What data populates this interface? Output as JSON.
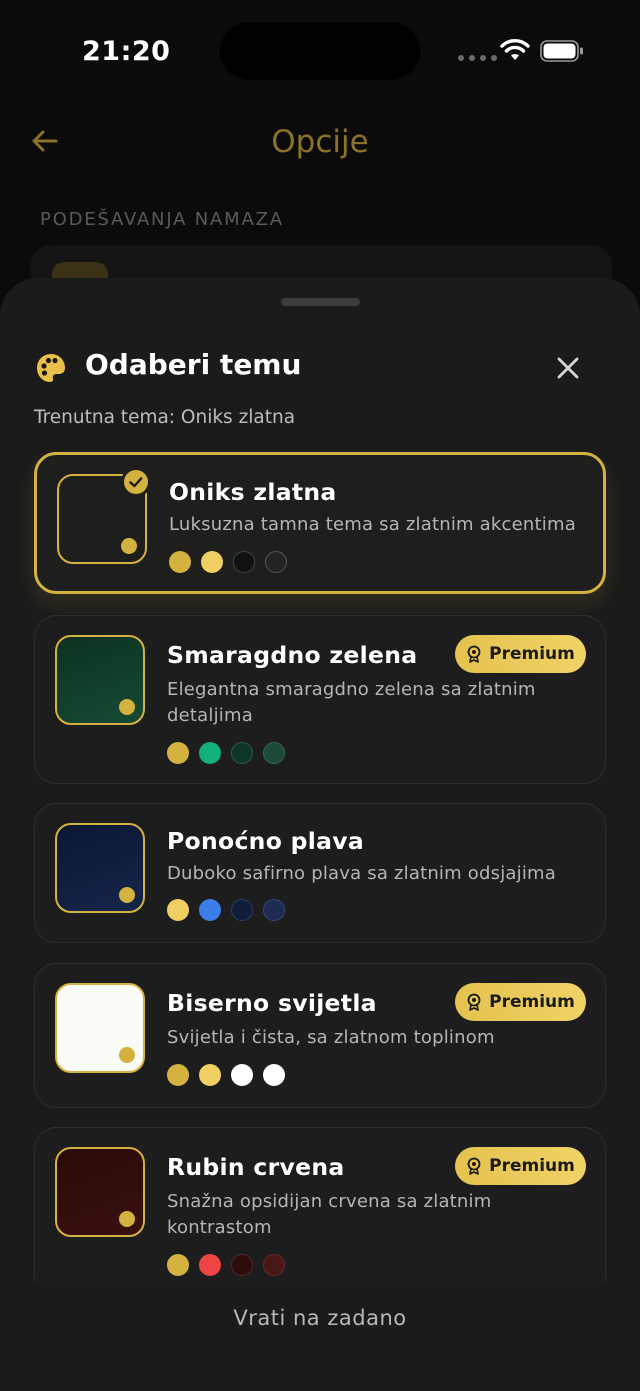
{
  "status": {
    "time": "21:20"
  },
  "page": {
    "title": "Opcije",
    "section": "PODEŠAVANJA NAMAZA"
  },
  "sheet": {
    "title": "Odaberi temu",
    "current_theme": "Trenutna tema: Oniks zlatna",
    "reset_label": "Vrati na zadano",
    "premium_label": "Premium"
  },
  "colors": {
    "accent": "#d4b23f",
    "sheet_bg": "#1b1b1b",
    "card_bg": "#1d1d1d"
  },
  "themes": [
    {
      "name": "Oniks zlatna",
      "desc": "Luksuzna tamna tema sa zlatnim akcentima",
      "selected": true,
      "premium": false,
      "swatch_bg": "#151515",
      "palette": [
        "#d4b23f",
        "#f0d062",
        "#111111",
        "#2a2a2a"
      ]
    },
    {
      "name": "Smaragdno zelena",
      "desc": "Elegantna smaragdno zelena sa zlatnim detaljima",
      "selected": false,
      "premium": true,
      "swatch_bg": "#0e3626",
      "palette": [
        "#d4b23f",
        "#13b07a",
        "#0e3626",
        "#1d4a36"
      ]
    },
    {
      "name": "Ponoćno plava",
      "desc": "Duboko safirno plava sa zlatnim odsjajima",
      "selected": false,
      "premium": false,
      "swatch_bg": "#0f1c3a",
      "palette": [
        "#f0d062",
        "#3b7ee8",
        "#0f1c3a",
        "#1c2b4f"
      ]
    },
    {
      "name": "Biserno svijetla",
      "desc": "Svijetla i čista, sa zlatnom toplinom",
      "selected": false,
      "premium": true,
      "swatch_bg": "#fbfbf8",
      "palette": [
        "#d4b23f",
        "#f0d062",
        "#ffffff",
        "#ffffff"
      ]
    },
    {
      "name": "Rubin crvena",
      "desc": "Snažna opsidijan crvena sa zlatnim kontrastom",
      "selected": false,
      "premium": true,
      "swatch_bg": "#2d0c0c",
      "palette": [
        "#d4b23f",
        "#ef4444",
        "#2d0c0c",
        "#4a1717"
      ]
    }
  ]
}
